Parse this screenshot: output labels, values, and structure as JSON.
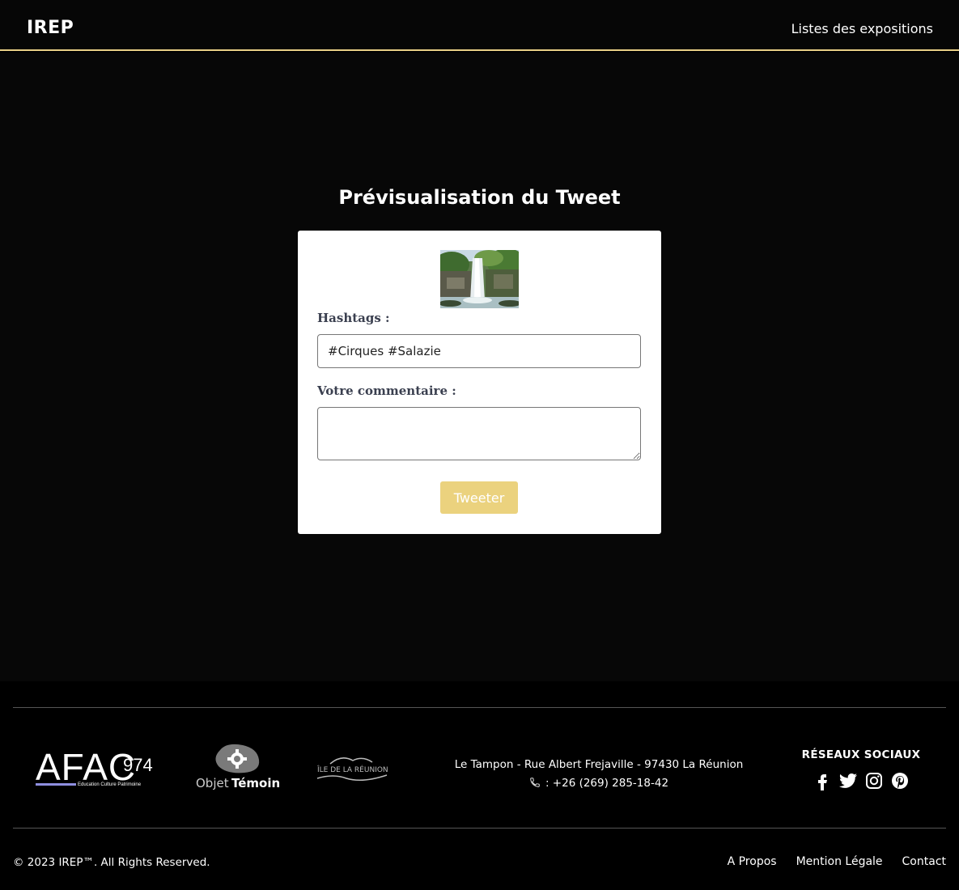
{
  "header": {
    "logo": "IREP",
    "nav_link": "Listes des expositions"
  },
  "main": {
    "title": "Prévisualisation du Tweet",
    "hashtags_label": "Hashtags :",
    "hashtags_value": "#Cirques #Salazie",
    "comment_label": "Votre commentaire :",
    "comment_value": "",
    "tweet_button": "Tweeter"
  },
  "footer": {
    "logos": {
      "afac_main": "AFAC",
      "afac_number": "974",
      "afac_tagline": "Education Culture Patrimoine",
      "objet_part1": "Objet",
      "objet_part2": "Témoin",
      "ile": "ÎLE DE LA RÉUNION"
    },
    "address": "Le Tampon - Rue Albert Frejaville - 97430 La Réunion",
    "phone": ": +26 (269) 285-18-42",
    "social_title": "RÉSEAUX SOCIAUX",
    "social_icons": [
      "facebook-icon",
      "twitter-icon",
      "instagram-icon",
      "pinterest-icon"
    ],
    "copyright": "© 2023 IREP™. All Rights Reserved.",
    "links": [
      "A Propos",
      "Mention Légale",
      "Contact"
    ]
  },
  "colors": {
    "accent": "#e8cf86",
    "button": "#ebd27e",
    "background": "#070707",
    "card": "#ffffff",
    "label": "#3a3f4f"
  }
}
